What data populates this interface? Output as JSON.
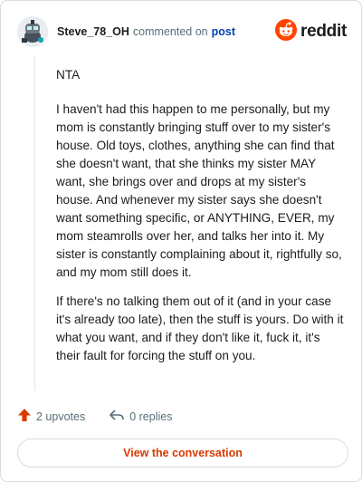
{
  "header": {
    "username": "Steve_78_OH",
    "action_text": "commented on",
    "link_text": "post",
    "brand": "reddit"
  },
  "comment": {
    "paragraphs": [
      "NTA",
      "I haven't had this happen to me personally, but my mom is constantly bringing stuff over to my sister's house. Old toys, clothes, anything she can find that she doesn't want, that she thinks my sister MAY want, she brings over and drops at my sister's house. And whenever my sister says she doesn't want something specific, or ANYTHING, EVER, my mom steamrolls over her, and talks her into it. My sister is constantly complaining about it, rightfully so, and my mom still does it.",
      "If there's no talking them out of it (and in your case it's already too late), then the stuff is yours. Do with it what you want, and if they don't like it, fuck it, it's their fault for forcing the stuff on you."
    ]
  },
  "actions": {
    "upvotes": "2 upvotes",
    "replies": "0 replies"
  },
  "cta": {
    "label": "View the conversation"
  },
  "colors": {
    "brand_orange": "#ff4500",
    "upvote": "#d93a00",
    "link": "#0045ac",
    "muted": "#576f76"
  },
  "icons": [
    "avatar",
    "reddit-logo-icon",
    "upvote-arrow-icon",
    "reply-icon"
  ]
}
